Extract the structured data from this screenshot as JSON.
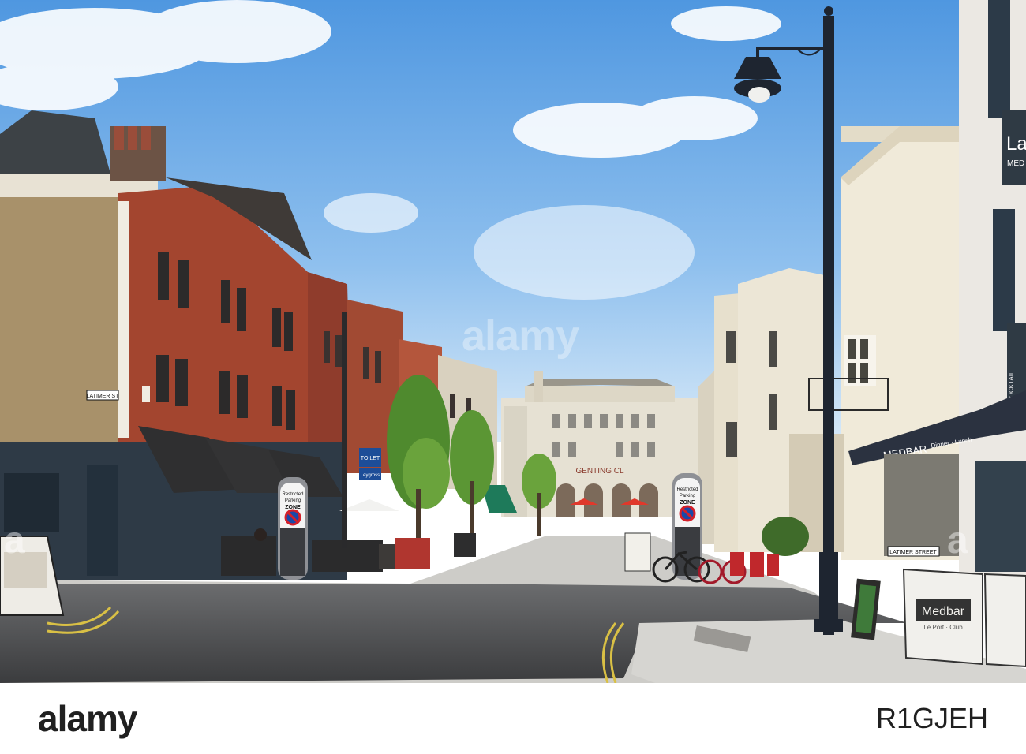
{
  "scene": {
    "sky_color": "#5fa3e6",
    "sky_light": "#cfe3f7",
    "road_color": "#4a4b4d",
    "pavement_color": "#c9c8c4",
    "brick_color": "#a3452f",
    "stone_color": "#ece6d6"
  },
  "signs": {
    "street_sign_left": "LATIMER ST",
    "to_let": "TO LET",
    "letting_agent": "Leygross",
    "restricted_left_line1": "Restricted",
    "restricted_left_line2": "Parking",
    "restricted_left_line3": "ZONE",
    "restricted_right_line1": "Restricted",
    "restricted_right_line2": "Parking",
    "restricted_right_line3": "ZONE",
    "building_name": "GENTING CL",
    "medbar_awning": "MEDBAR",
    "medbar_awning_sub": "Dinner · Lunch",
    "medbar_banner": "Medbar",
    "medbar_banner_sub": "Le Port · Club",
    "latimer_street_sign": "LATIMER STREET",
    "right_shop_sign": "La",
    "right_shop_sub": "MED",
    "cocktail_sign": "COCKTAIL"
  },
  "watermark": {
    "center": "alamy",
    "left": "a",
    "right": "a"
  },
  "footer": {
    "logo": "alamy",
    "image_id": "R1GJEH"
  }
}
